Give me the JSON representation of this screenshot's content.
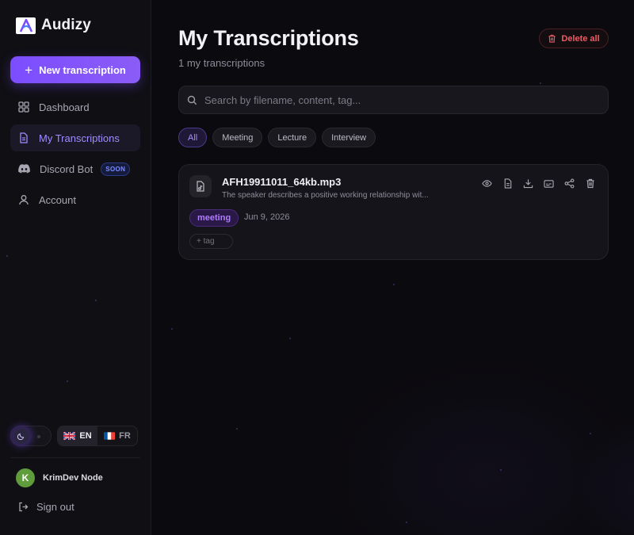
{
  "brand": {
    "name": "Audizy"
  },
  "sidebar": {
    "new_button": "New transcription",
    "items": [
      {
        "label": "Dashboard",
        "icon": "grid-icon",
        "active": false
      },
      {
        "label": "My Transcriptions",
        "icon": "document-icon",
        "active": true
      },
      {
        "label": "Discord Bot",
        "icon": "discord-icon",
        "active": false,
        "badge": "SOON"
      },
      {
        "label": "Account",
        "icon": "user-icon",
        "active": false
      }
    ],
    "theme": "dark",
    "languages": [
      {
        "code": "EN",
        "flag": "uk-flag",
        "active": true
      },
      {
        "code": "FR",
        "flag": "france-flag",
        "active": false
      }
    ],
    "user": {
      "initial": "K",
      "name": "KrimDev Node",
      "avatar_color": "#5f9c3c"
    },
    "signout": "Sign out"
  },
  "main": {
    "title": "My Transcriptions",
    "subtitle": "1 my transcriptions",
    "delete_all": "Delete all",
    "search_placeholder": "Search by filename, content, tag...",
    "filters": [
      {
        "label": "All",
        "active": true
      },
      {
        "label": "Meeting",
        "active": false
      },
      {
        "label": "Lecture",
        "active": false
      },
      {
        "label": "Interview",
        "active": false
      }
    ],
    "transcriptions": [
      {
        "filename": "AFH19911011_64kb.mp3",
        "description": "The speaker describes a positive working relationship wit...",
        "tag": "meeting",
        "date": "Jun 9, 2026",
        "add_tag": "+ tag",
        "actions": [
          "eye-icon",
          "document-icon",
          "download-icon",
          "subtitles-icon",
          "share-icon",
          "trash-icon"
        ]
      }
    ]
  },
  "colors": {
    "accent": "#7c4dff",
    "danger": "#f05a64",
    "tag": "#b07cff"
  }
}
